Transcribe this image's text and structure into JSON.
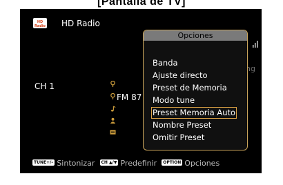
{
  "caption": "[Pantalla de TV]",
  "header": {
    "logo_text": "HD Radio",
    "source": "HD Radio"
  },
  "info": {
    "channel": "CH 1",
    "frequency": "FM 87",
    "partial_text": "ng"
  },
  "bottom_bar": {
    "items": [
      {
        "badge": "TUNE+/–",
        "label": "Sintonizar"
      },
      {
        "badge": "CH ▲/▼",
        "label": "Predefinir"
      },
      {
        "badge": "OPTION",
        "label": "Opciones"
      }
    ]
  },
  "menu": {
    "title": "Opciones",
    "items": [
      {
        "label": "Banda",
        "selected": false
      },
      {
        "label": "Ajuste directo",
        "selected": false
      },
      {
        "label": "Preset de Memoria",
        "selected": false
      },
      {
        "label": "Modo tune",
        "selected": false
      },
      {
        "label": "Preset Memoria Auto",
        "selected": true
      },
      {
        "label": "Nombre Preset",
        "selected": false
      },
      {
        "label": "Omitir Preset",
        "selected": false
      }
    ]
  },
  "icons": [
    "location-pin-icon",
    "location-pin-icon",
    "music-note-icon",
    "person-icon",
    "tag-icon",
    "signal-icon"
  ],
  "colors": {
    "screen_background": "#000000",
    "menu_border": "#c8a35a",
    "menu_header": "#7a7a7a",
    "selection_border": "#d9a044",
    "info_icon": "#c99a3b",
    "hd_logo": "#d8441b"
  }
}
